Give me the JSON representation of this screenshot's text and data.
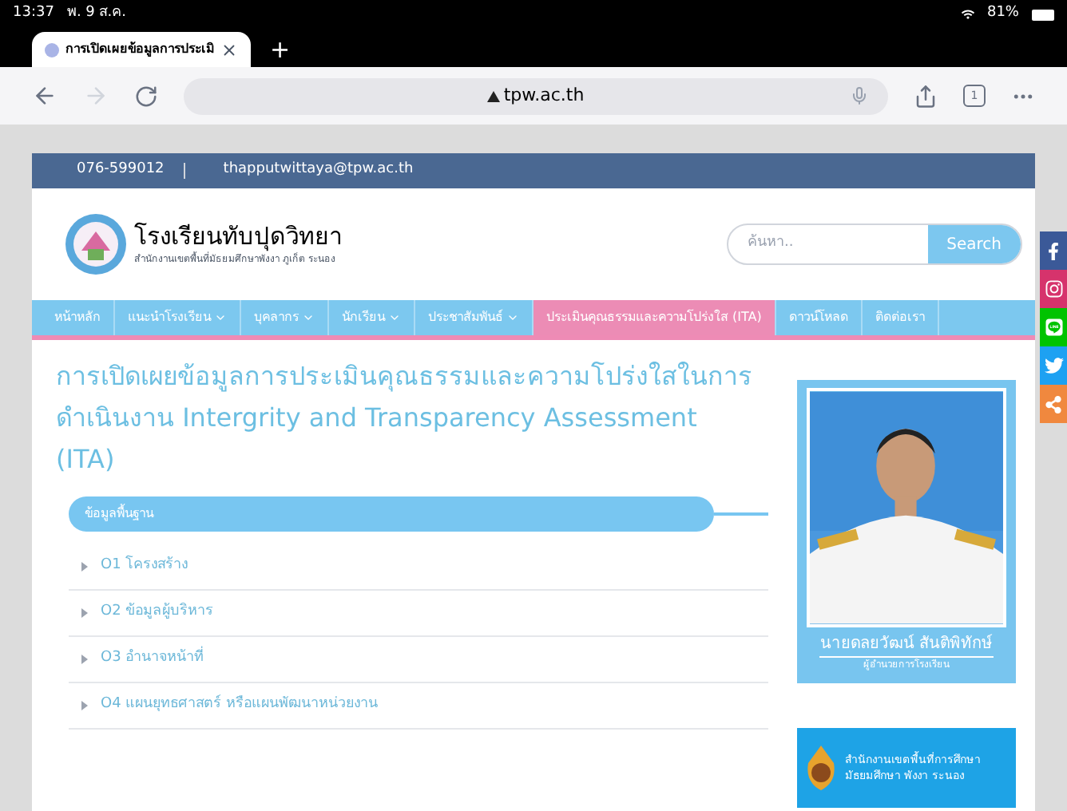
{
  "status_bar": {
    "time": "13:37",
    "date": "พ. 9 ส.ค.",
    "battery": "81%"
  },
  "browser": {
    "tab_title": "การเปิดเผยข้อมูลการประเมิ",
    "new_tab": "+",
    "url": "tpw.ac.th",
    "tab_count": "1"
  },
  "topbar": {
    "phone": "076-599012",
    "email": "thapputwittaya@tpw.ac.th"
  },
  "header": {
    "school_name": "โรงเรียนทับปุดวิทยา",
    "subtitle": "สำนักงานเขตพื้นที่มัธยมศึกษาพังงา ภูเก็ต ระนอง",
    "search": {
      "placeholder": "ค้นหา..",
      "button": "Search"
    }
  },
  "nav": [
    {
      "label": "หน้าหลัก",
      "dropdown": false,
      "selected": false
    },
    {
      "label": "แนะนำโรงเรียน",
      "dropdown": true,
      "selected": false
    },
    {
      "label": "บุคลากร",
      "dropdown": true,
      "selected": false
    },
    {
      "label": "นักเรียน",
      "dropdown": true,
      "selected": false
    },
    {
      "label": "ประชาสัมพันธ์",
      "dropdown": true,
      "selected": false
    },
    {
      "label": "ประเมินคุณธรรมและความโปร่งใส (ITA)",
      "dropdown": false,
      "selected": true
    },
    {
      "label": "ดาวน์โหลด",
      "dropdown": false,
      "selected": false
    },
    {
      "label": "ติดต่อเรา",
      "dropdown": false,
      "selected": false
    }
  ],
  "page_title": "การเปิดเผยข้อมูลการประเมินคุณธรรมและความโปร่งใสในการดำเนินงาน Intergrity and Transparency Assessment (ITA)",
  "section": {
    "title": "ข้อมูลพื้นฐาน",
    "items": [
      "O1 โครงสร้าง",
      "O2 ข้อมูลผู้บริหาร",
      "O3 อำนาจหน้าที่",
      "O4 แผนยุทธศาสตร์ หรือแผนพัฒนาหน่วยงาน"
    ]
  },
  "director": {
    "name": "นายดลยวัฒน์ สันติพิทักษ์",
    "position": "ผู้อำนวยการโรงเรียน"
  },
  "banner": {
    "lines": [
      "สำนักงานเขตพื้นที่การศึกษา",
      "มัธยมศึกษา พังงา ระนอง"
    ]
  },
  "social": [
    {
      "kind": "facebook",
      "color": "#3b5998"
    },
    {
      "kind": "instagram",
      "color": "#d6336c"
    },
    {
      "kind": "line",
      "color": "#00c300"
    },
    {
      "kind": "twitter",
      "color": "#1da1f2"
    },
    {
      "kind": "share",
      "color": "#f0883e"
    }
  ]
}
